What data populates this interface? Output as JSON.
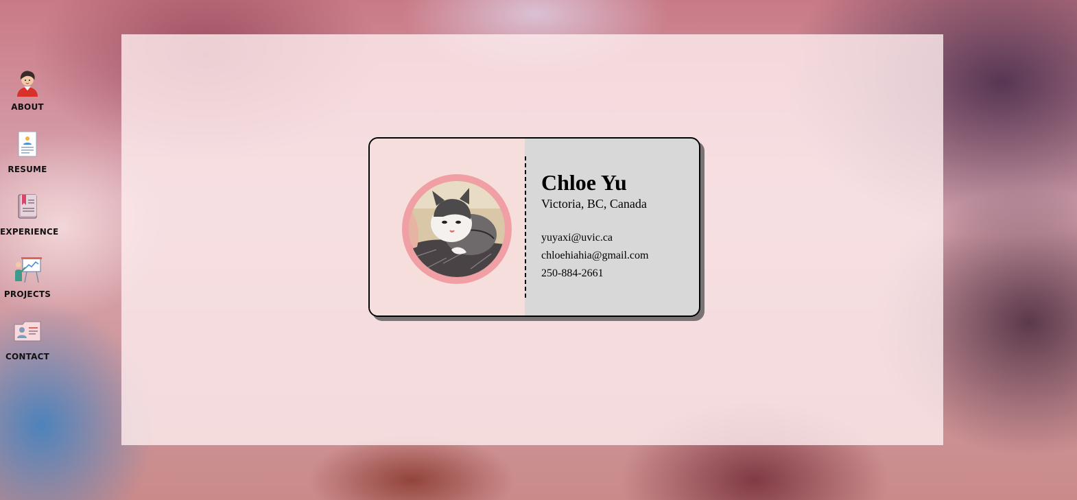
{
  "nav": {
    "items": [
      {
        "label": "ABOUT",
        "icon": "person-avatar-icon"
      },
      {
        "label": "RESUME",
        "icon": "resume-document-icon"
      },
      {
        "label": "EXPERIENCE",
        "icon": "bookmark-book-icon"
      },
      {
        "label": "PROJECTS",
        "icon": "presentation-board-icon"
      },
      {
        "label": "CONTACT",
        "icon": "contact-card-icon"
      }
    ]
  },
  "card": {
    "name": "Chloe Yu",
    "location": "Victoria, BC, Canada",
    "email_school": "yuyaxi@uvic.ca",
    "email_personal": "chloehiahia@gmail.com",
    "phone": "250-884-2661",
    "photo_icon": "cat-photo"
  },
  "colors": {
    "card_left": "#f6dedd",
    "card_right": "#d8d8d8",
    "avatar_ring": "#f0a0a4",
    "panel": "#fcebed"
  }
}
